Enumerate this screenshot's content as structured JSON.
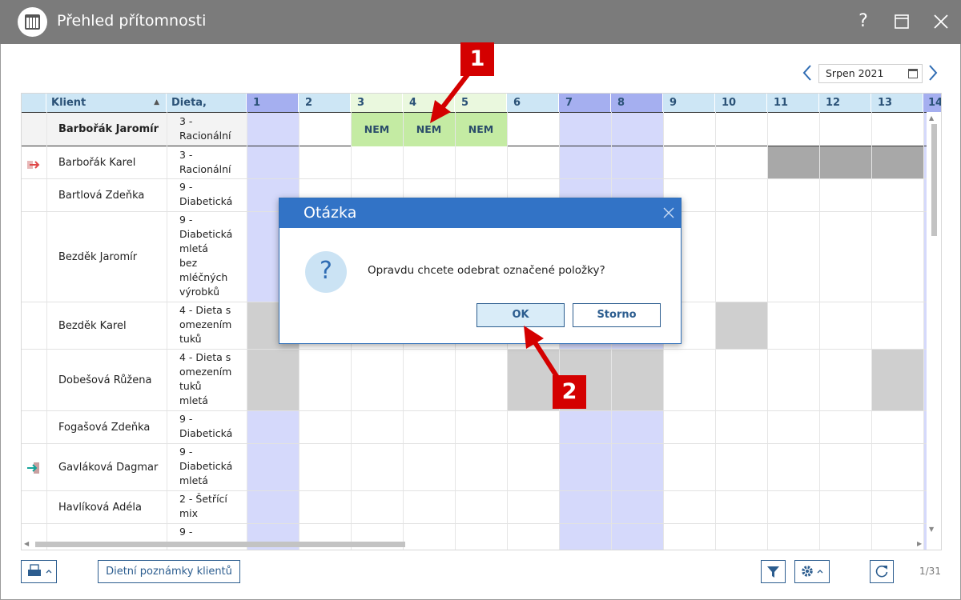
{
  "window": {
    "title": "Přehled přítomnosti",
    "help": "?",
    "maximize": "☐",
    "close": "✕"
  },
  "date_nav": {
    "prev": "‹",
    "month": "Srpen 2021",
    "next": "›"
  },
  "table": {
    "headers": [
      "Klient",
      "Dieta, form..."
    ],
    "days": [
      "1",
      "2",
      "3",
      "4",
      "5",
      "6",
      "7",
      "8",
      "9",
      "10",
      "11",
      "12",
      "13",
      "14"
    ],
    "rows": [
      {
        "name": "Barbořák Jaromír",
        "diet": [
          "3 -",
          "Racionální"
        ]
      },
      {
        "name": "Barbořák Karel",
        "diet": [
          "3 -",
          "Racionální"
        ]
      },
      {
        "name": "Bartlová Zdeňka",
        "diet": [
          "9 -",
          "Diabetická"
        ]
      },
      {
        "name": "Bezděk Jaromír",
        "diet": [
          "9 -",
          "Diabetická",
          "mletá",
          "bez",
          "mléčných",
          "výrobků"
        ]
      },
      {
        "name": "Bezděk Karel",
        "diet": [
          "4 - Dieta s",
          "omezením",
          "tuků"
        ]
      },
      {
        "name": "Dobešová Růžena",
        "diet": [
          "4 - Dieta s",
          "omezením",
          "tuků",
          "mletá"
        ]
      },
      {
        "name": "Fogašová Zdeňka",
        "diet": [
          "9 -",
          "Diabetická"
        ]
      },
      {
        "name": "Gavláková Dagmar",
        "diet": [
          "9 -",
          "Diabetická",
          "mletá"
        ]
      },
      {
        "name": "Havlíková Adéla",
        "diet": [
          "2 - Šetřící",
          "mix"
        ]
      },
      {
        "name": "",
        "diet": [
          "9 -"
        ]
      }
    ],
    "nem_label": "NEM"
  },
  "dialog": {
    "title": "Otázka",
    "close": "✕",
    "icon": "question-icon",
    "message": "Opravdu chcete odebrat označené položky?",
    "ok": "OK",
    "cancel": "Storno"
  },
  "annotations": {
    "one": "1",
    "two": "2"
  },
  "footer": {
    "notes_button": "Dietní poznámky klientů",
    "page": "1/31"
  },
  "colors": {
    "titlebar": "#7b7b7b",
    "header": "#cde6f5",
    "weekend": "#d5d9fb",
    "nem": "#c4eba3",
    "dialog_head": "#3273c6",
    "arrow": "#d40000"
  }
}
